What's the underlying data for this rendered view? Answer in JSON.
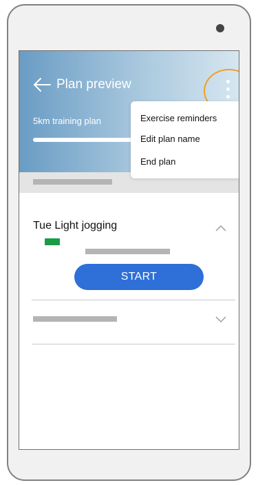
{
  "header": {
    "title": "Plan preview",
    "plan_name": "5km training plan",
    "progress": 1.0
  },
  "menu": {
    "items": [
      {
        "label": "Exercise reminders"
      },
      {
        "label": "Edit plan name"
      },
      {
        "label": "End plan"
      }
    ]
  },
  "workout": {
    "day": "Tue",
    "name": "Light jogging",
    "title_text": "Tue  Light jogging",
    "start_label": "START"
  },
  "colors": {
    "accent": "#2e6fd8",
    "highlight": "#f0a020",
    "tag": "#1a9b46"
  }
}
